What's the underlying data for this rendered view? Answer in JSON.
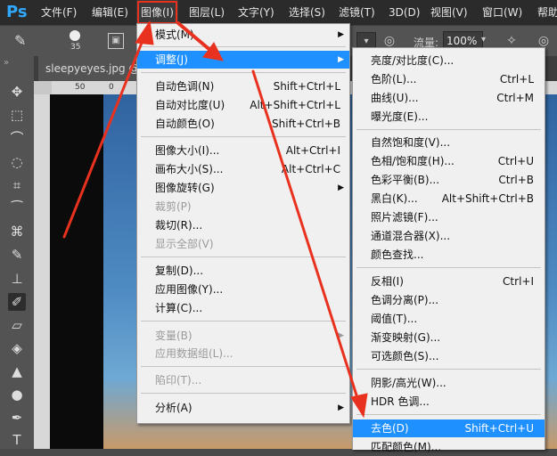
{
  "menubar": {
    "logo": "Ps",
    "items": [
      "文件(F)",
      "编辑(E)",
      "图像(I)",
      "图层(L)",
      "文字(Y)",
      "选择(S)",
      "滤镜(T)",
      "3D(D)",
      "视图(V)",
      "窗口(W)",
      "帮助"
    ],
    "active_index": 2
  },
  "options_bar": {
    "brush_size": "35",
    "flow_label": "流量:",
    "flow_value": "100%"
  },
  "document": {
    "tab_title": "sleepyeyes.jpg @ 6",
    "ruler_marks": [
      "50",
      "0"
    ]
  },
  "image_menu": {
    "items": [
      {
        "label": "模式(M)",
        "shortcut": "",
        "submenu": true,
        "disabled": false
      },
      {
        "label": "调整(J)",
        "shortcut": "",
        "submenu": true,
        "disabled": false,
        "highlight": true
      },
      {
        "label": "自动色调(N)",
        "shortcut": "Shift+Ctrl+L",
        "disabled": false
      },
      {
        "label": "自动对比度(U)",
        "shortcut": "Alt+Shift+Ctrl+L",
        "disabled": false
      },
      {
        "label": "自动颜色(O)",
        "shortcut": "Shift+Ctrl+B",
        "disabled": false
      },
      {
        "label": "图像大小(I)...",
        "shortcut": "Alt+Ctrl+I",
        "disabled": false
      },
      {
        "label": "画布大小(S)...",
        "shortcut": "Alt+Ctrl+C",
        "disabled": false
      },
      {
        "label": "图像旋转(G)",
        "shortcut": "",
        "submenu": true,
        "disabled": false
      },
      {
        "label": "裁剪(P)",
        "shortcut": "",
        "disabled": true
      },
      {
        "label": "裁切(R)...",
        "shortcut": "",
        "disabled": false
      },
      {
        "label": "显示全部(V)",
        "shortcut": "",
        "disabled": true
      },
      {
        "label": "复制(D)...",
        "shortcut": "",
        "disabled": false
      },
      {
        "label": "应用图像(Y)...",
        "shortcut": "",
        "disabled": false
      },
      {
        "label": "计算(C)...",
        "shortcut": "",
        "disabled": false
      },
      {
        "label": "变量(B)",
        "shortcut": "",
        "submenu": true,
        "disabled": true
      },
      {
        "label": "应用数据组(L)...",
        "shortcut": "",
        "disabled": true
      },
      {
        "label": "陷印(T)...",
        "shortcut": "",
        "disabled": true
      },
      {
        "label": "分析(A)",
        "shortcut": "",
        "submenu": true,
        "disabled": false
      }
    ]
  },
  "adjust_menu": {
    "items": [
      {
        "label": "亮度/对比度(C)...",
        "shortcut": ""
      },
      {
        "label": "色阶(L)...",
        "shortcut": "Ctrl+L"
      },
      {
        "label": "曲线(U)...",
        "shortcut": "Ctrl+M"
      },
      {
        "label": "曝光度(E)...",
        "shortcut": ""
      },
      {
        "label": "自然饱和度(V)...",
        "shortcut": ""
      },
      {
        "label": "色相/饱和度(H)...",
        "shortcut": "Ctrl+U"
      },
      {
        "label": "色彩平衡(B)...",
        "shortcut": "Ctrl+B"
      },
      {
        "label": "黑白(K)...",
        "shortcut": "Alt+Shift+Ctrl+B"
      },
      {
        "label": "照片滤镜(F)...",
        "shortcut": ""
      },
      {
        "label": "通道混合器(X)...",
        "shortcut": ""
      },
      {
        "label": "颜色查找...",
        "shortcut": ""
      },
      {
        "label": "反相(I)",
        "shortcut": "Ctrl+I"
      },
      {
        "label": "色调分离(P)...",
        "shortcut": ""
      },
      {
        "label": "阈值(T)...",
        "shortcut": ""
      },
      {
        "label": "渐变映射(G)...",
        "shortcut": ""
      },
      {
        "label": "可选颜色(S)...",
        "shortcut": ""
      },
      {
        "label": "阴影/高光(W)...",
        "shortcut": ""
      },
      {
        "label": "HDR 色调...",
        "shortcut": ""
      },
      {
        "label": "去色(D)",
        "shortcut": "Shift+Ctrl+U",
        "highlight": true
      },
      {
        "label": "匹配颜色(M)...",
        "shortcut": ""
      }
    ]
  },
  "colors": {
    "highlight": "#1e90ff",
    "annotation": "#e8321f"
  }
}
